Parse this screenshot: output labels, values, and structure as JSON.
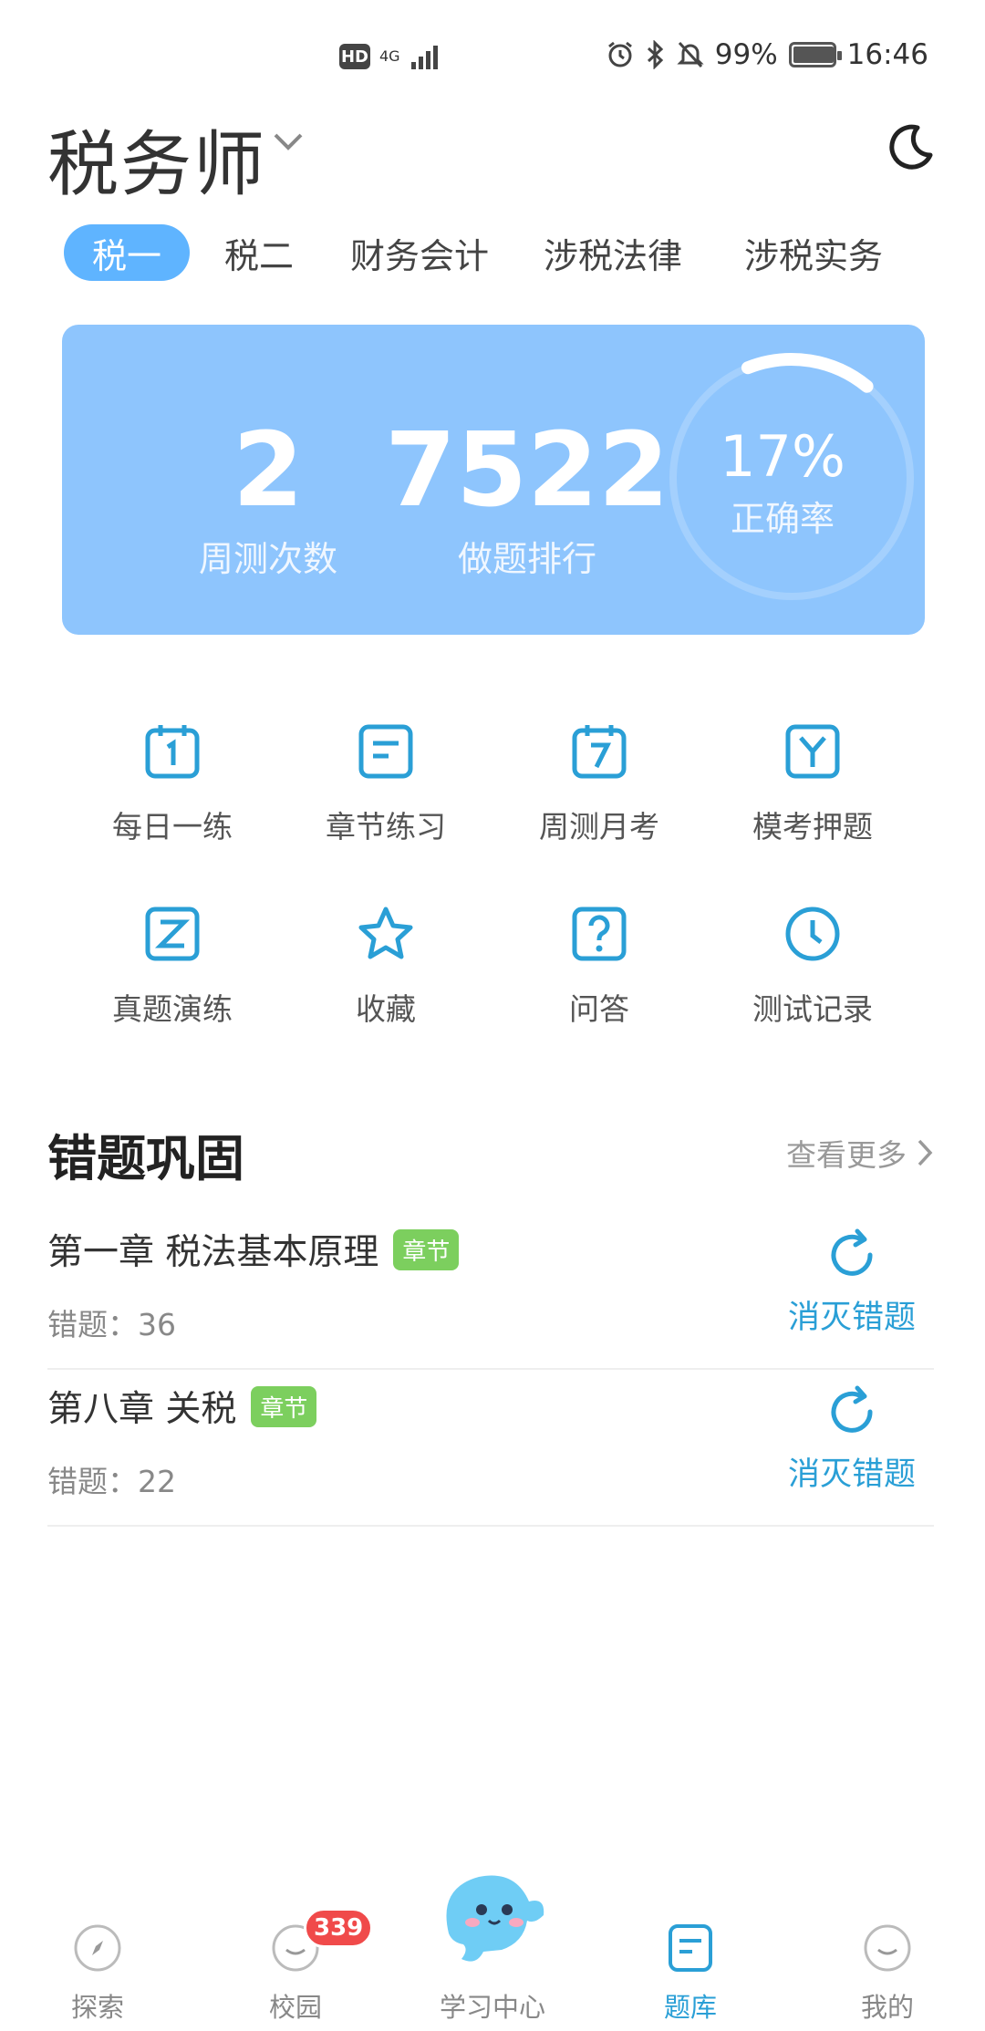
{
  "status_bar": {
    "hd": "HD",
    "network": "4G",
    "battery": "99%",
    "time": "16:46"
  },
  "header": {
    "title": "税务师"
  },
  "tabs": [
    {
      "label": "税一",
      "active": true
    },
    {
      "label": "税二",
      "active": false
    },
    {
      "label": "财务会计",
      "active": false
    },
    {
      "label": "涉税法律",
      "active": false
    },
    {
      "label": "涉税实务",
      "active": false
    }
  ],
  "stats": {
    "weekly_tests": {
      "value": "2",
      "label": "周测次数"
    },
    "rank": {
      "value": "7522",
      "label": "做题排行"
    },
    "accuracy": {
      "value": "17%",
      "label": "正确率",
      "fraction": 0.17
    }
  },
  "grid": [
    {
      "label": "每日一练",
      "icon": "calendar-1-icon"
    },
    {
      "label": "章节练习",
      "icon": "chapter-icon"
    },
    {
      "label": "周测月考",
      "icon": "calendar-7-icon"
    },
    {
      "label": "模考押题",
      "icon": "y-mark-icon"
    },
    {
      "label": "真题演练",
      "icon": "z-mark-icon"
    },
    {
      "label": "收藏",
      "icon": "star-icon"
    },
    {
      "label": "问答",
      "icon": "question-icon"
    },
    {
      "label": "测试记录",
      "icon": "clock-icon"
    }
  ],
  "wrong_section": {
    "title": "错题巩固",
    "more": "查看更多",
    "items": [
      {
        "title": "第一章 税法基本原理",
        "tag": "章节",
        "count": "错题：36",
        "action": "消灭错题"
      },
      {
        "title": "第八章 关税",
        "tag": "章节",
        "count": "错题：22",
        "action": "消灭错题"
      }
    ]
  },
  "bottom_nav": [
    {
      "label": "探索",
      "icon": "compass-icon"
    },
    {
      "label": "校园",
      "icon": "campus-icon",
      "badge": "339"
    },
    {
      "label": "学习中心",
      "icon": "mascot-icon"
    },
    {
      "label": "题库",
      "icon": "question-bank-icon",
      "active": true
    },
    {
      "label": "我的",
      "icon": "profile-icon"
    }
  ],
  "colors": {
    "accent": "#2a9fd6",
    "tab_active": "#5fb4ff",
    "card": "#8ec5fd",
    "chip": "#7ccf5e",
    "badge": "#f04a4a"
  }
}
